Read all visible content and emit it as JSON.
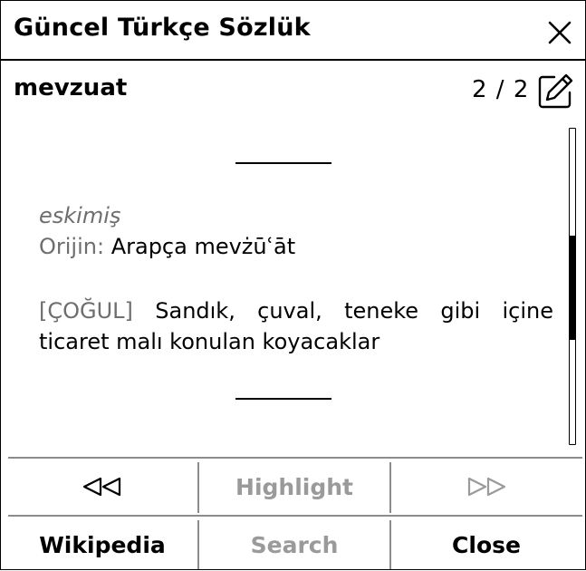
{
  "dialog": {
    "title": "Güncel Türkçe Sözlük",
    "close_icon": "close-icon"
  },
  "entry": {
    "headword": "mevzuat",
    "counter": "2 / 2",
    "edit_icon": "edit-icon",
    "separator": "————",
    "usage_label": "eskimiş",
    "origin_label": "Orijin:",
    "origin_value": "Arapça mevżūʿāt",
    "category_tag": "[ÇOĞUL]",
    "definition": "Sandık, çuval, teneke gibi içine ticaret malı konulan koyacaklar"
  },
  "scrollbar": {
    "position_fraction": 0.34,
    "visible_fraction": 0.33
  },
  "buttons": {
    "prev_icon": "double-triangle-left-icon",
    "highlight": "Highlight",
    "next_icon": "double-triangle-right-icon",
    "wikipedia": "Wikipedia",
    "search": "Search",
    "close": "Close"
  },
  "colors": {
    "text": "#000000",
    "muted": "#6e6e6e",
    "disabled": "#9a9a9a",
    "divider": "#8c8c8c",
    "background": "#ffffff"
  }
}
